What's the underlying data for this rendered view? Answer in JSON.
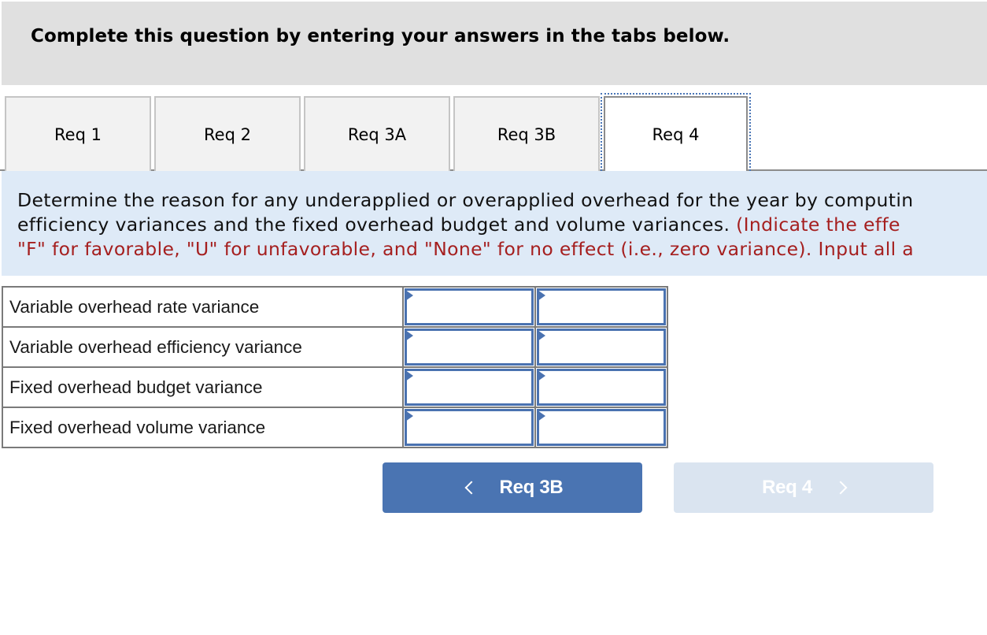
{
  "header": {
    "title": "Complete this question by entering your answers in the tabs below."
  },
  "tabs": [
    {
      "label": "Req 1",
      "active": false
    },
    {
      "label": "Req 2",
      "active": false
    },
    {
      "label": "Req 3A",
      "active": false
    },
    {
      "label": "Req 3B",
      "active": false
    },
    {
      "label": "Req 4",
      "active": true
    }
  ],
  "instructions": {
    "line1": "Determine the reason for any underapplied or overapplied overhead for the year by computin",
    "line2_black": "efficiency variances and the fixed overhead budget and volume variances. ",
    "line2_red": "(Indicate the effe",
    "line3_red": "\"F\" for favorable, \"U\" for unfavorable, and \"None\" for no effect (i.e., zero variance). Input all a"
  },
  "answer_table": {
    "rows": [
      {
        "label": "Variable overhead rate variance",
        "amount": "",
        "effect": ""
      },
      {
        "label": "Variable overhead efficiency variance",
        "amount": "",
        "effect": ""
      },
      {
        "label": "Fixed overhead budget variance",
        "amount": "",
        "effect": ""
      },
      {
        "label": "Fixed overhead volume variance",
        "amount": "",
        "effect": ""
      }
    ]
  },
  "navigation": {
    "prev_label": "Req 3B",
    "next_label": "Req 4",
    "prev_icon": "chevron-left-icon",
    "next_icon": "chevron-right-icon",
    "next_disabled": true
  },
  "colors": {
    "accent": "#4a74b2",
    "instruction_red": "#a51f1f",
    "instruction_bg": "#deeaf7",
    "header_bg": "#e0e0e0"
  }
}
